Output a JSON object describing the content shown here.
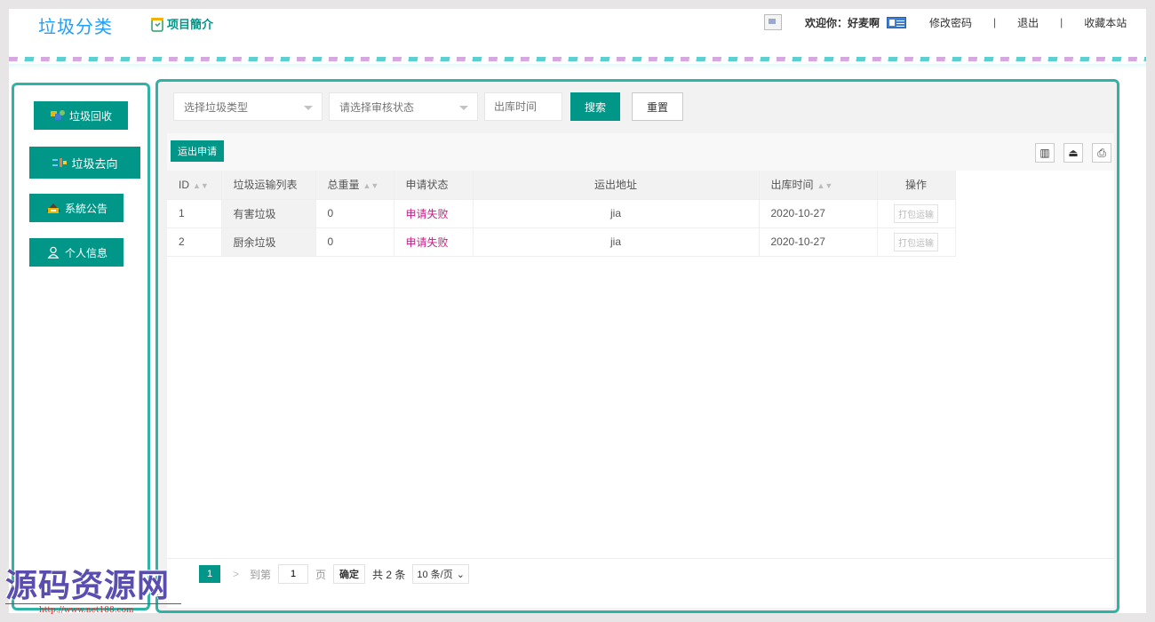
{
  "header": {
    "logo": "垃圾分类",
    "intro": "项目簡介",
    "welcome": "欢迎你：好麦啊",
    "links": [
      "修改密码",
      "退出",
      "收藏本站"
    ],
    "separator": "|"
  },
  "sidebar": {
    "items": [
      {
        "label": "垃圾回收",
        "icon": "recycle-icon"
      },
      {
        "label": "垃圾去向",
        "icon": "direction-icon"
      },
      {
        "label": "系統公告",
        "icon": "announcement-icon"
      },
      {
        "label": "个人信息",
        "icon": "user-icon"
      }
    ]
  },
  "filters": {
    "type_placeholder": "选择垃圾类型",
    "status_placeholder": "请选择审核状态",
    "date_placeholder": "出库时间",
    "search": "搜索",
    "reset": "重置"
  },
  "toolbar": {
    "apply": "运出申请",
    "tools": [
      "columns-icon",
      "export-icon",
      "print-icon"
    ]
  },
  "table": {
    "columns": [
      "ID",
      "垃圾运输列表",
      "总重量",
      "申请状态",
      "运出地址",
      "出库时间",
      "操作"
    ],
    "rows": [
      {
        "id": "1",
        "list": "有害垃圾",
        "weight": "0",
        "status": "申请失败",
        "address": "jia",
        "date": "2020-10-27",
        "action": "打包运输"
      },
      {
        "id": "2",
        "list": "厨余垃圾",
        "weight": "0",
        "status": "申请失败",
        "address": "jia",
        "date": "2020-10-27",
        "action": "打包运输"
      }
    ]
  },
  "pager": {
    "current": "1",
    "next": ">",
    "goto": "到第",
    "page_value": "1",
    "page_unit": "页",
    "confirm": "确定",
    "total": "共 2 条",
    "size": "10 条/页"
  },
  "watermark": {
    "text": "源码资源网",
    "url": "http://www.net188.com"
  }
}
